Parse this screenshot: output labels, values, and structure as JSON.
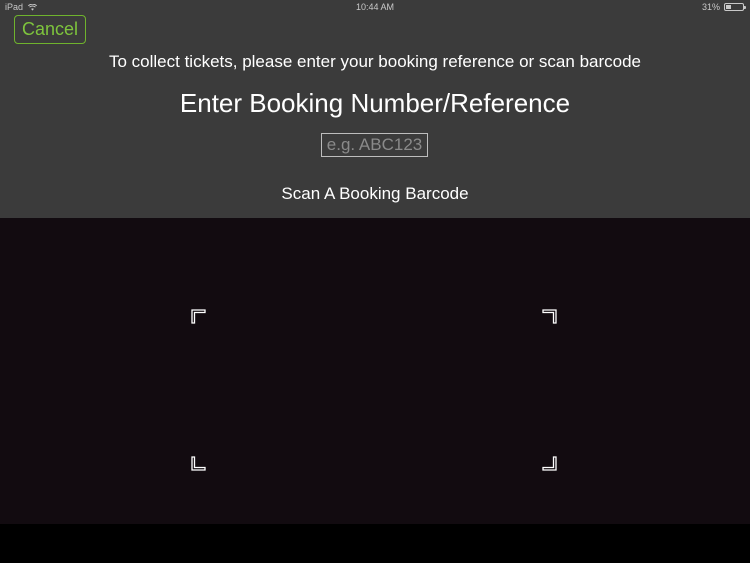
{
  "status_bar": {
    "device": "iPad",
    "time": "10:44 AM",
    "battery_percent_label": "31%",
    "battery_level": 0.31
  },
  "header": {
    "cancel_label": "Cancel",
    "instructions": "To collect tickets, please enter your booking reference or scan barcode",
    "title": "Enter Booking Number/Reference"
  },
  "booking_input": {
    "placeholder": "e.g. ABC123",
    "value": ""
  },
  "scan": {
    "label": "Scan A Booking Barcode"
  },
  "icons": {
    "wifi": "wifi-icon",
    "battery": "battery-icon",
    "scanner_corners": [
      "scan-corner-top-left-icon",
      "scan-corner-top-right-icon",
      "scan-corner-bottom-left-icon",
      "scan-corner-bottom-right-icon"
    ]
  },
  "colors": {
    "panel_background": "#3b3b3b",
    "accent_green": "#7ec43d",
    "camera_background": "#120b10"
  }
}
